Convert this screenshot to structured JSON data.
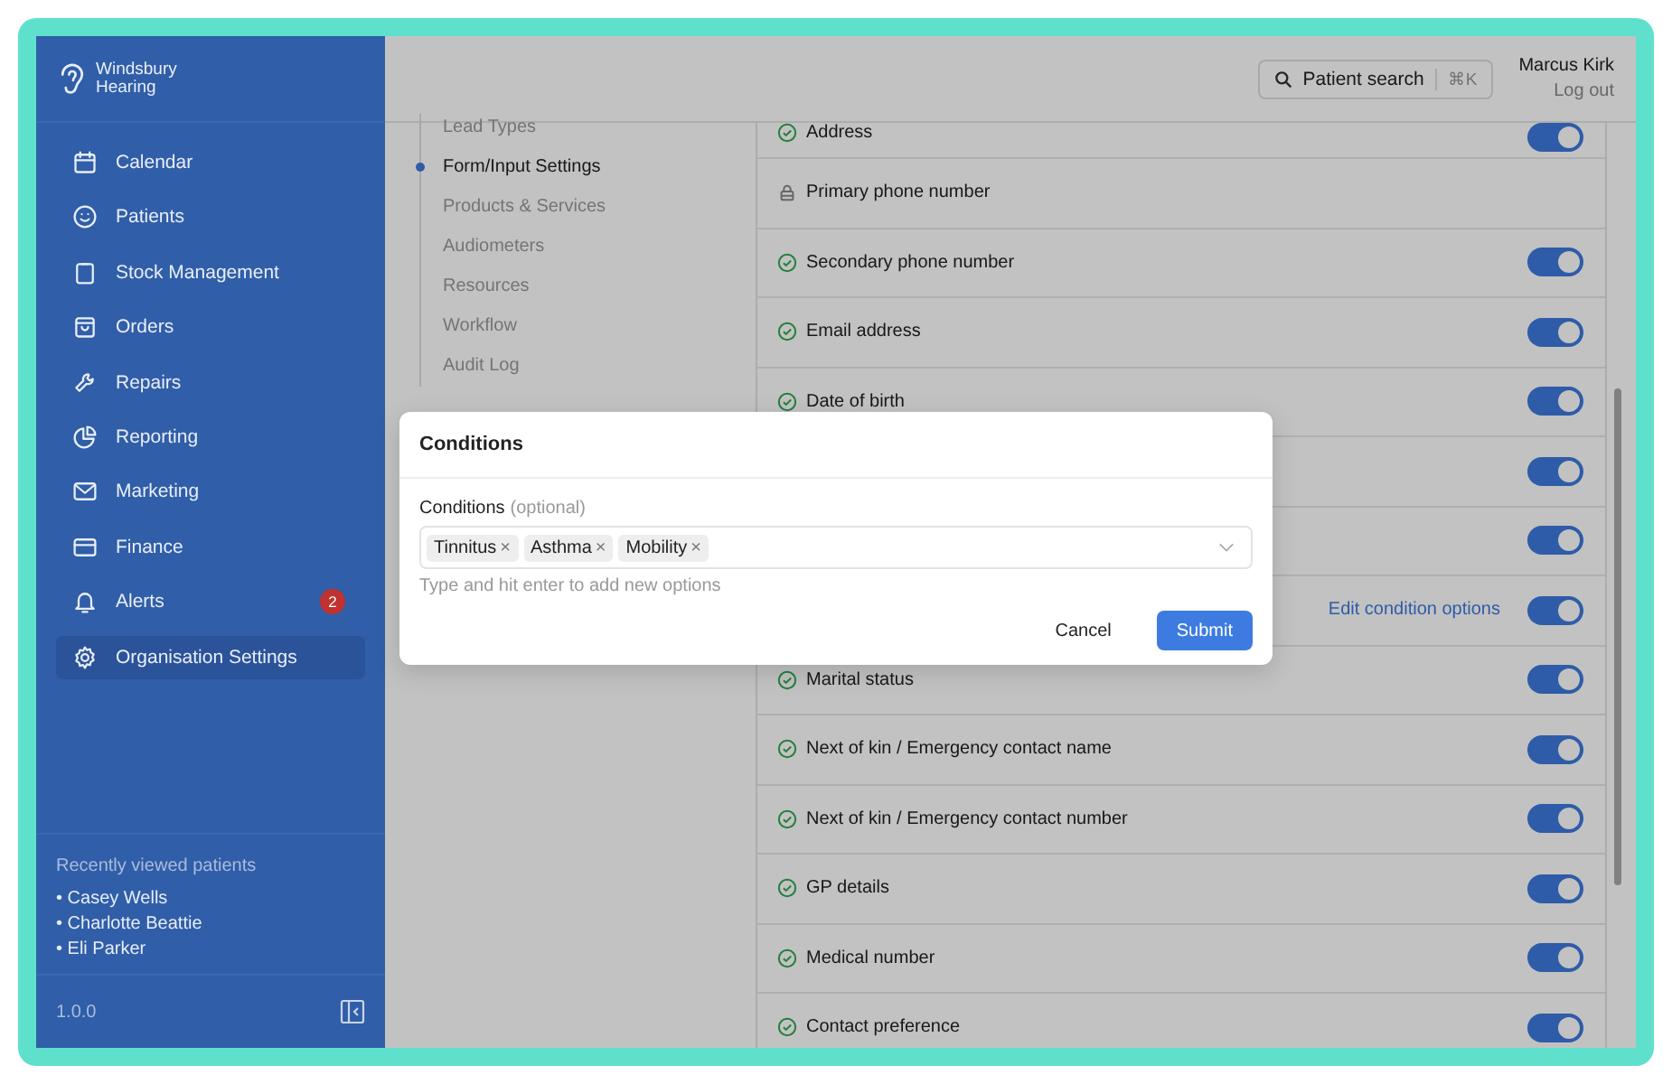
{
  "brand": {
    "name_line1": "Windsbury",
    "name_line2": "Hearing"
  },
  "nav": [
    {
      "label": "Calendar",
      "selected": false
    },
    {
      "label": "Patients",
      "selected": false
    },
    {
      "label": "Stock Management",
      "selected": false
    },
    {
      "label": "Orders",
      "selected": false
    },
    {
      "label": "Repairs",
      "selected": false
    },
    {
      "label": "Reporting",
      "selected": false
    },
    {
      "label": "Marketing",
      "selected": false
    },
    {
      "label": "Finance",
      "selected": false
    },
    {
      "label": "Alerts",
      "selected": false,
      "badge": "2"
    },
    {
      "label": "Organisation Settings",
      "selected": true
    }
  ],
  "recent": {
    "title": "Recently viewed patients",
    "bullet": "•",
    "patients": [
      "Casey Wells",
      "Charlotte Beattie",
      "Eli Parker"
    ]
  },
  "version": "1.0.0",
  "header": {
    "search": {
      "label": "Patient search",
      "shortcut": "⌘K"
    },
    "user": "Marcus Kirk",
    "logout": "Log out"
  },
  "settings_nav": [
    {
      "label": "Lead Types",
      "selected": false
    },
    {
      "label": "Form/Input Settings",
      "selected": true
    },
    {
      "label": "Products & Services",
      "selected": false
    },
    {
      "label": "Audiometers",
      "selected": false
    },
    {
      "label": "Resources",
      "selected": false
    },
    {
      "label": "Workflow",
      "selected": false
    },
    {
      "label": "Audit Log",
      "selected": false
    }
  ],
  "fields": [
    {
      "kind": "check",
      "label": "Address",
      "on": true
    },
    {
      "kind": "locked",
      "label": "Primary phone number"
    },
    {
      "kind": "check",
      "label": "Secondary phone number",
      "on": true
    },
    {
      "kind": "check",
      "label": "Email address",
      "on": true
    },
    {
      "kind": "check",
      "label": "Date of birth",
      "on": true
    },
    {
      "kind": "hidden",
      "on": true
    },
    {
      "kind": "hidden",
      "on": true
    },
    {
      "kind": "hidden",
      "link": "Edit condition options",
      "on": true
    },
    {
      "kind": "check",
      "label": "Marital status",
      "on": true
    },
    {
      "kind": "check",
      "label": "Next of kin / Emergency contact name",
      "on": true
    },
    {
      "kind": "check",
      "label": "Next of kin / Emergency contact number",
      "on": true
    },
    {
      "kind": "check",
      "label": "GP details",
      "on": true
    },
    {
      "kind": "check",
      "label": "Medical number",
      "on": true
    },
    {
      "kind": "check",
      "label": "Contact preference",
      "on": true
    }
  ],
  "modal": {
    "title": "Conditions",
    "field_label": "Conditions",
    "field_hint": "(optional)",
    "tags": [
      "Tinnitus",
      "Asthma",
      "Mobility"
    ],
    "tag_remove": "×",
    "helper": "Type and hit enter to add new options",
    "buttons": [
      {
        "label": "Cancel",
        "kind": "secondary"
      },
      {
        "label": "Submit",
        "kind": "primary"
      }
    ]
  }
}
